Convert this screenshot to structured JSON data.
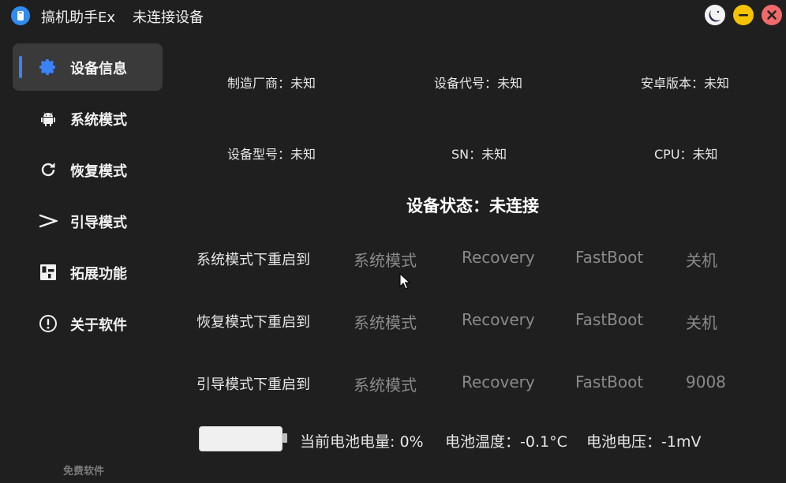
{
  "window": {
    "app_name": "搞机助手Ex",
    "connection_title": "未连接设备"
  },
  "sidebar": {
    "items": [
      {
        "label": "设备信息",
        "icon": "gear-icon",
        "active": true
      },
      {
        "label": "系统模式",
        "icon": "android-icon",
        "active": false
      },
      {
        "label": "恢复模式",
        "icon": "refresh-icon",
        "active": false
      },
      {
        "label": "引导模式",
        "icon": "chevron-right-icon",
        "active": false
      },
      {
        "label": "拓展功能",
        "icon": "extensions-icon",
        "active": false
      },
      {
        "label": "关于软件",
        "icon": "info-icon",
        "active": false
      }
    ],
    "footer": "免费软件"
  },
  "device_info": {
    "manufacturer": "制造厂商：未知",
    "codename": "设备代号：未知",
    "android_version": "安卓版本：未知",
    "model": "设备型号：未知",
    "sn": "SN：未知",
    "cpu": "CPU：未知"
  },
  "status": "设备状态：未连接",
  "reboot_rows": [
    {
      "label": "系统模式下重启到",
      "options": [
        "系统模式",
        "Recovery",
        "FastBoot",
        "关机"
      ]
    },
    {
      "label": "恢复模式下重启到",
      "options": [
        "系统模式",
        "Recovery",
        "FastBoot",
        "关机"
      ]
    },
    {
      "label": "引导模式下重启到",
      "options": [
        "系统模式",
        "Recovery",
        "FastBoot",
        "9008"
      ]
    }
  ],
  "battery": {
    "level_text": "当前电池电量: 0%",
    "temperature_text": "电池温度：-0.1°C",
    "voltage_text": "电池电压：-1mV",
    "level_fraction": 0
  },
  "colors": {
    "accent": "#3b82f6",
    "background": "#1f1f1f",
    "option_text": "#8a8a8a"
  }
}
